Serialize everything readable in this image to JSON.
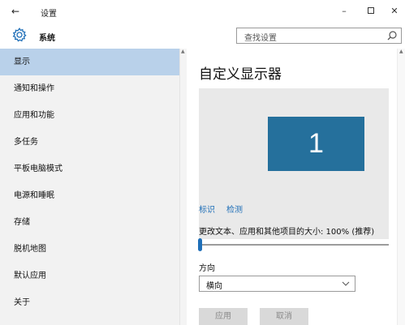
{
  "window": {
    "back_glyph": "←",
    "title": "设置",
    "minimize_glyph": "–",
    "close_glyph": "✕"
  },
  "header": {
    "app_name": "系统",
    "icon": "gear-icon",
    "search": {
      "placeholder": "查找设置",
      "icon": "search-icon"
    }
  },
  "sidebar": {
    "selected_index": 0,
    "items": [
      {
        "label": "显示"
      },
      {
        "label": "通知和操作"
      },
      {
        "label": "应用和功能"
      },
      {
        "label": "多任务"
      },
      {
        "label": "平板电脑模式"
      },
      {
        "label": "电源和睡眠"
      },
      {
        "label": "存储"
      },
      {
        "label": "脱机地图"
      },
      {
        "label": "默认应用"
      },
      {
        "label": "关于"
      }
    ]
  },
  "main": {
    "title": "自定义显示器",
    "monitor_number": "1",
    "identify_link": "标识",
    "detect_link": "检测",
    "scale_label": "更改文本、应用和其他项目的大小: 100% (推荐)",
    "scale_slider_position": 0.0,
    "orientation_label": "方向",
    "orientation_value": "横向",
    "apply_button": "应用",
    "cancel_button": "取消"
  },
  "colors": {
    "accent": "#1f6fb8",
    "selection": "#b9d1ea",
    "monitor": "#25709c",
    "sidebar_bg": "#f2f2f2",
    "preview_bg": "#e9e9e9"
  }
}
